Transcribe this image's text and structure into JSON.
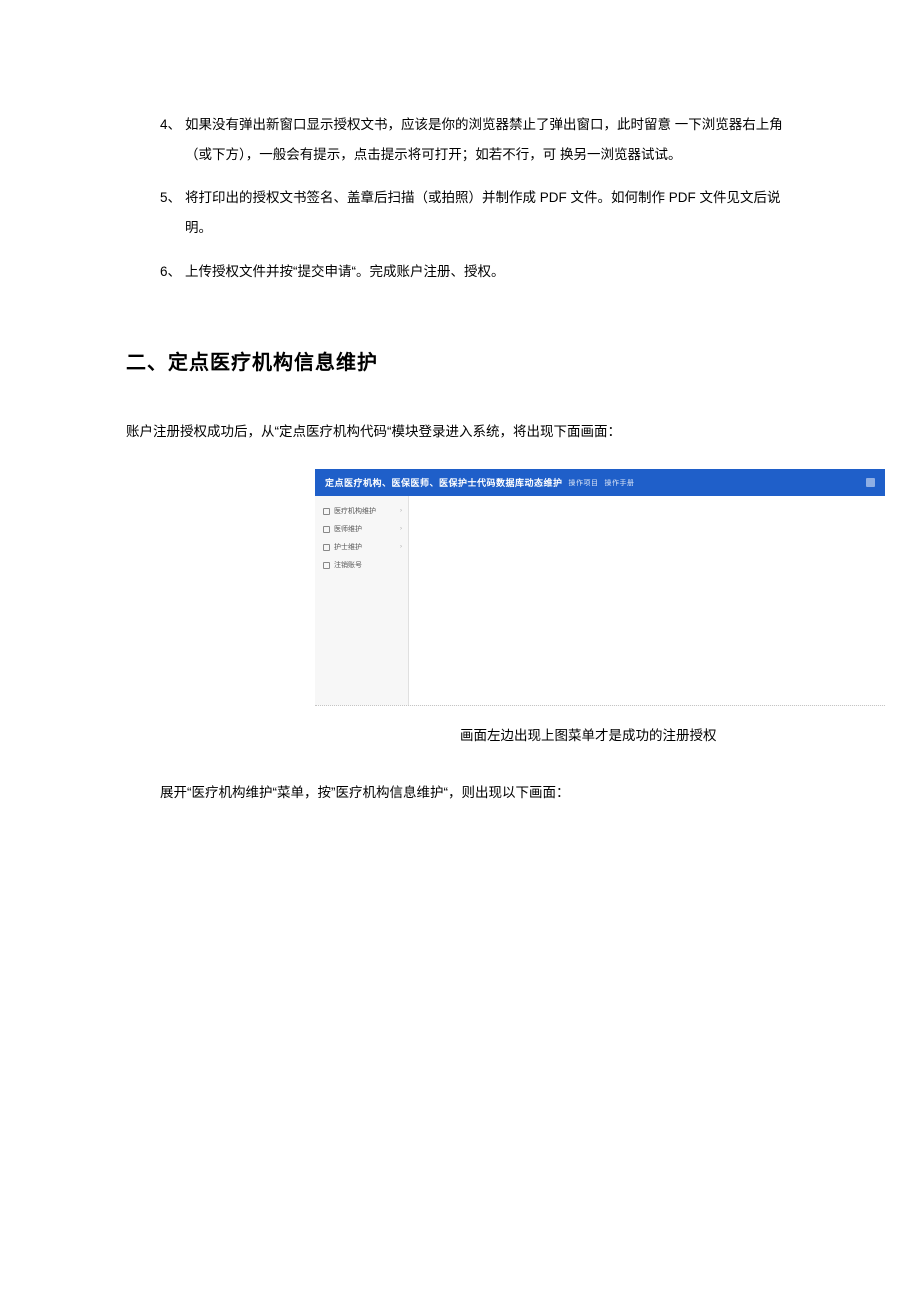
{
  "list": [
    {
      "num": "4、",
      "text": "如果没有弹出新窗口显示授权文书，应该是你的浏览器禁止了弹出窗口，此时留意 一下浏览器右上角（或下方），一般会有提示，点击提示将可打开；如若不行，可 换另一浏览器试试。"
    },
    {
      "num": "5、",
      "text": " 将打印出的授权文书签名、盖章后扫描（或拍照）并制作成 PDF 文件。如何制作 PDF 文件见文后说明。"
    },
    {
      "num": "6、",
      "text": "上传授权文件并按“提交申请“。完成账户注册、授权。"
    }
  ],
  "heading": "二、定点医疗机构信息维护",
  "paragraph1": "账户注册授权成功后，从“定点医疗机构代码“模块登录进入系统，将出现下面画面：",
  "app": {
    "title": "定点医疗机构、医保医师、医保护士代码数据库动态维护",
    "sub1": "操作项目",
    "sub2": "操作手册",
    "sidebar": [
      {
        "label": "医疗机构维护",
        "has_chevron": true
      },
      {
        "label": "医师维护",
        "has_chevron": true
      },
      {
        "label": "护士维护",
        "has_chevron": true
      },
      {
        "label": "注销账号",
        "has_chevron": false
      }
    ]
  },
  "caption": "画面左边出现上图菜单才是成功的注册授权",
  "paragraph2": "展开“医疗机构维护“菜单，按”医疗机构信息维护“，则出现以下画面："
}
